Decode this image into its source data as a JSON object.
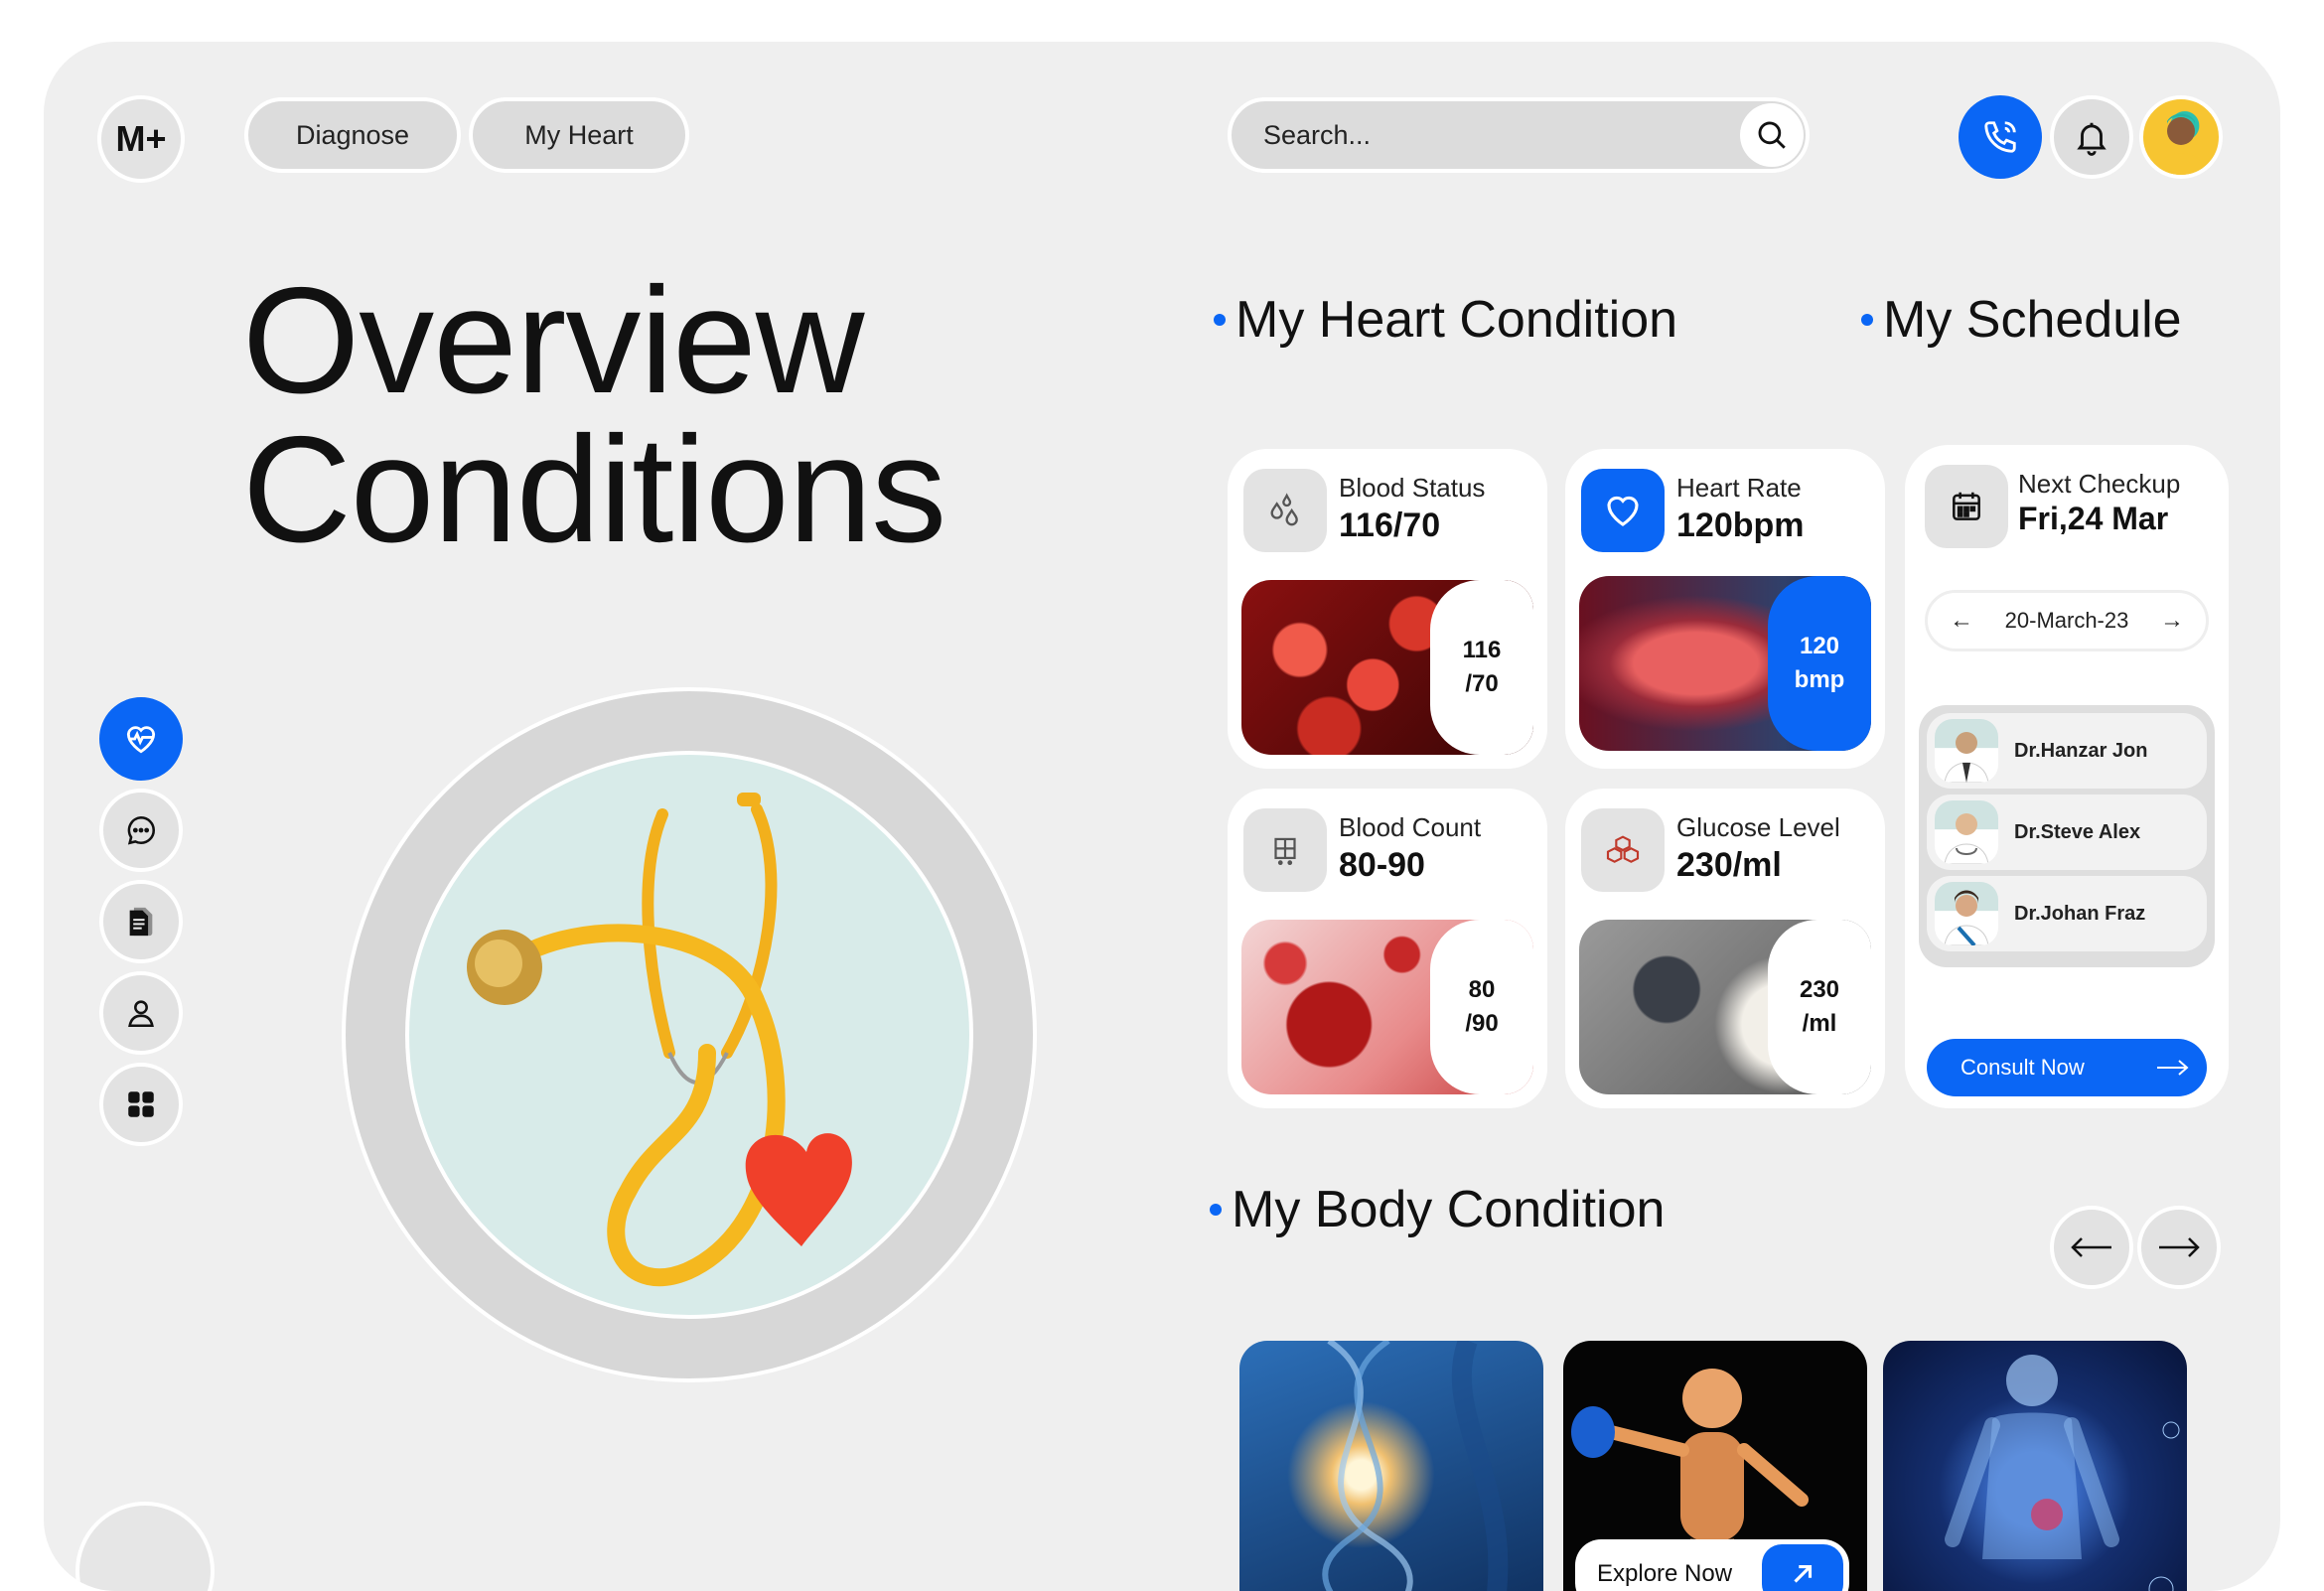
{
  "header": {
    "logo": "M+",
    "nav": [
      "Diagnose",
      "My Heart"
    ],
    "search_placeholder": "Search..."
  },
  "hero": {
    "title_line1": "Overview",
    "title_line2": "Conditions"
  },
  "sections": {
    "heart": "My Heart Condition",
    "schedule": "My Schedule",
    "body": "My Body Condition"
  },
  "cards": [
    {
      "label": "Blood Status",
      "value": "116/70",
      "tag_line1": "116",
      "tag_line2": "/70"
    },
    {
      "label": "Heart Rate",
      "value": "120bpm",
      "tag_line1": "120",
      "tag_line2": "bmp"
    },
    {
      "label": "Blood Count",
      "value": "80-90",
      "tag_line1": "80",
      "tag_line2": "/90"
    },
    {
      "label": "Glucose Level",
      "value": "230/ml",
      "tag_line1": "230",
      "tag_line2": "/ml"
    }
  ],
  "schedule": {
    "label": "Next Checkup",
    "value": "Fri,24 Mar",
    "date": "20-March-23",
    "doctors": [
      "Dr.Hanzar Jon",
      "Dr.Steve Alex",
      "Dr.Johan Fraz"
    ],
    "cta": "Consult Now"
  },
  "body_cards": {
    "explore": "Explore Now"
  },
  "colors": {
    "accent": "#0a66f5",
    "background": "#efefef",
    "card": "#ffffff"
  }
}
